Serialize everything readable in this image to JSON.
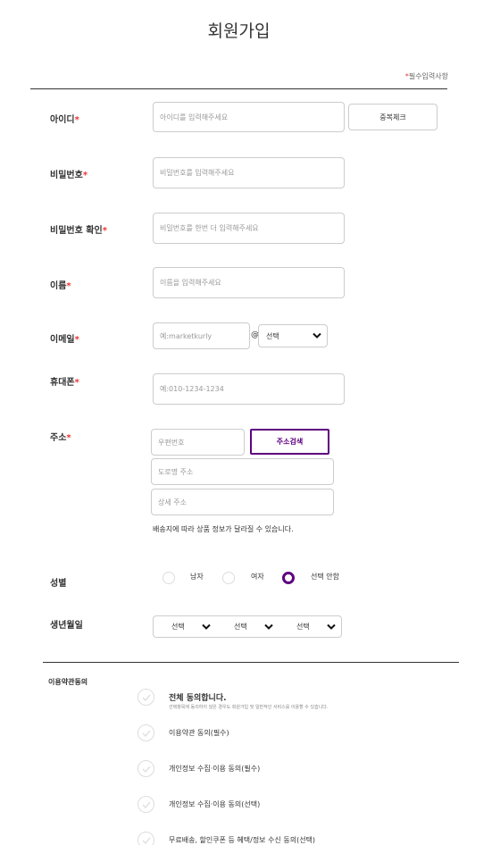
{
  "page_title": "회원가입",
  "required_note": {
    "star": "*",
    "text": "필수입력사항"
  },
  "fields": {
    "id": {
      "label": "아이디",
      "placeholder": "아이디를 입력해주세요",
      "button": "중복체크"
    },
    "password": {
      "label": "비밀번호",
      "placeholder": "비밀번호를 입력해주세요"
    },
    "password_confirm": {
      "label": "비밀번호 확인",
      "placeholder": "비밀번호를 한번 더 입력해주세요"
    },
    "name": {
      "label": "이름",
      "placeholder": "이름을 입력해주세요"
    },
    "email": {
      "label": "이메일",
      "placeholder": "예:marketkurly",
      "at": "@",
      "domain_select": "선택"
    },
    "phone": {
      "label": "휴대폰",
      "placeholder": "예:010-1234-1234"
    },
    "address": {
      "label": "주소",
      "zip_placeholder": "우편번호",
      "search_button": "주소검색",
      "road_placeholder": "도로명 주소",
      "detail_placeholder": "상세 주소",
      "note": "배송지에 따라 상품 정보가 달라질 수 있습니다."
    },
    "gender": {
      "label": "성별",
      "options": [
        "남자",
        "여자",
        "선택 안함"
      ],
      "selected": "선택 안함"
    },
    "birth": {
      "label": "생년월일",
      "year": "선택",
      "month": "선택",
      "day": "선택"
    }
  },
  "star": "*",
  "terms": {
    "heading": "이용약관동의",
    "items": [
      {
        "label": "전체 동의합니다.",
        "sub": "선택항목에 동의하지 않은 경우도 회원가입 및 일반적인 서비스를 이용할 수 있습니다."
      },
      {
        "label": "이용약관 동의(필수)"
      },
      {
        "label": "개인정보 수집·이용 동의(필수)"
      },
      {
        "label": "개인정보 수집·이용 동의(선택)"
      },
      {
        "label": "무료배송, 할인쿠폰 등 혜택/정보 수신 동의(선택)"
      }
    ]
  },
  "colors": {
    "accent": "#5f0080",
    "required": "#ee3333",
    "border": "#cccccc"
  }
}
